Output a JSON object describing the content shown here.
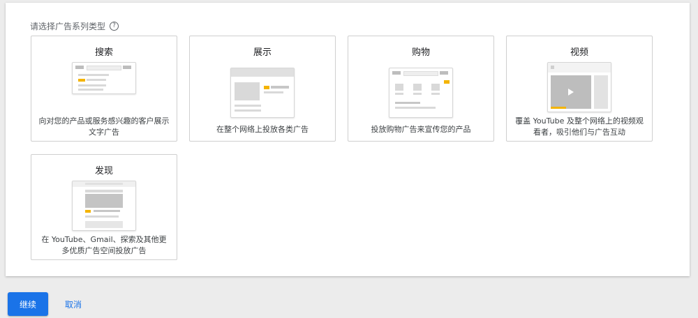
{
  "prompt": {
    "label": "请选择广告系列类型",
    "help_icon": "question-circle-icon"
  },
  "cards": [
    {
      "title": "搜索",
      "description": "向对您的产品或服务感兴趣的客户展示文字广告"
    },
    {
      "title": "展示",
      "description": "在整个网络上投放各类广告"
    },
    {
      "title": "购物",
      "description": "投放购物广告来宣传您的产品"
    },
    {
      "title": "视频",
      "description": "覆盖 YouTube 及整个网络上的视频观看者，吸引他们与广告互动"
    },
    {
      "title": "发现",
      "description": "在 YouTube、Gmail、探索及其他更多优质广告空间投放广告"
    }
  ],
  "actions": {
    "continue_label": "继续",
    "cancel_label": "取消"
  },
  "colors": {
    "accent": "#1a73e8",
    "highlight": "#f4b400"
  }
}
